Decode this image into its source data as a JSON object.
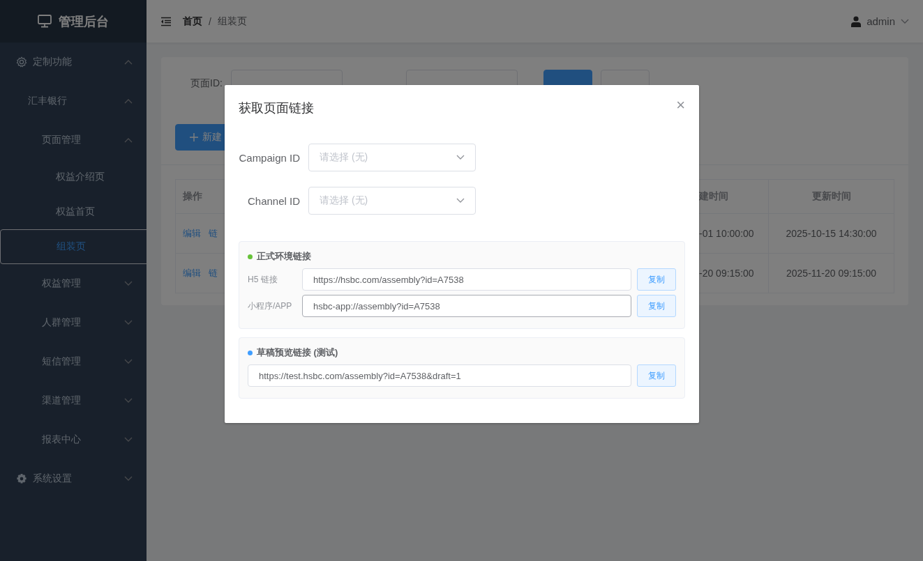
{
  "sidebar": {
    "title": "管理后台",
    "menu": [
      {
        "label": "定制功能",
        "expanded": true,
        "children": [
          {
            "label": "汇丰银行",
            "expanded": true,
            "children": [
              {
                "label": "页面管理",
                "expanded": true,
                "children": [
                  {
                    "label": "权益介绍页",
                    "selected": false
                  },
                  {
                    "label": "权益首页",
                    "selected": false
                  },
                  {
                    "label": "组装页",
                    "selected": true
                  }
                ]
              },
              {
                "label": "权益管理",
                "expanded": false
              },
              {
                "label": "人群管理",
                "expanded": false
              },
              {
                "label": "短信管理",
                "expanded": false
              },
              {
                "label": "渠道管理",
                "expanded": false
              },
              {
                "label": "报表中心",
                "expanded": false
              }
            ]
          }
        ]
      },
      {
        "label": "系统设置",
        "expanded": false
      }
    ]
  },
  "header": {
    "breadcrumb": [
      "首页",
      "组装页"
    ],
    "breadcrumb_separator": "/",
    "user": "admin"
  },
  "filter": {
    "label": "页面ID:"
  },
  "new_button": "新建",
  "table": {
    "columns": [
      "操作",
      "建时间",
      "更新时间"
    ],
    "rows": [
      {
        "actions": [
          "编辑",
          "链"
        ],
        "column_2": "-01 10:00:00",
        "column_3": "2025-10-15 14:30:00"
      },
      {
        "actions": [
          "编辑",
          "链"
        ],
        "column_2": "-20 09:15:00",
        "column_3": "2025-11-20 09:15:00"
      }
    ]
  },
  "dialog": {
    "title": "获取页面链接",
    "close": "×",
    "selects": [
      {
        "label": "Campaign ID",
        "placeholder": "请选择 (无)"
      },
      {
        "label": "Channel ID",
        "placeholder": "请选择 (无)"
      }
    ],
    "sections": [
      {
        "title": "正式环境链接",
        "color": "#67c23a",
        "links": [
          {
            "label": "H5 链接",
            "value": "https://hsbc.com/assembly?id=A7538",
            "button": "复制",
            "focused": false
          },
          {
            "label": "小程序/APP",
            "value": "hsbc-app://assembly?id=A7538",
            "button": "复制",
            "focused": true
          }
        ]
      },
      {
        "title": "草稿预览链接 (测试)",
        "color": "#409eff",
        "links": [
          {
            "value": "https://test.hsbc.com/assembly?id=A7538&draft=1",
            "button": "复制",
            "focused": false
          }
        ]
      }
    ]
  }
}
